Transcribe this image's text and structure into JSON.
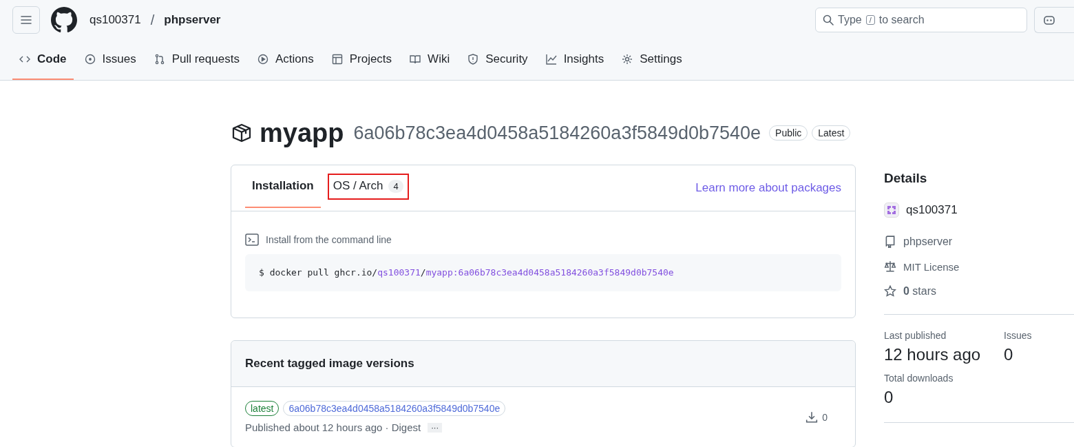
{
  "header": {
    "owner": "qs100371",
    "separator": "/",
    "repo": "phpserver",
    "search_parts": [
      "Type",
      "/",
      "to search"
    ]
  },
  "nav": [
    {
      "label": "Code",
      "kind": "code",
      "selected": true
    },
    {
      "label": "Issues",
      "kind": "issue",
      "selected": false
    },
    {
      "label": "Pull requests",
      "kind": "pr",
      "selected": false
    },
    {
      "label": "Actions",
      "kind": "play",
      "selected": false
    },
    {
      "label": "Projects",
      "kind": "table",
      "selected": false
    },
    {
      "label": "Wiki",
      "kind": "book",
      "selected": false
    },
    {
      "label": "Security",
      "kind": "shield",
      "selected": false
    },
    {
      "label": "Insights",
      "kind": "graph",
      "selected": false
    },
    {
      "label": "Settings",
      "kind": "gear",
      "selected": false
    }
  ],
  "package": {
    "name": "myapp",
    "digest": "6a06b78c3ea4d0458a5184260a3f5849d0b7540e",
    "badges": [
      "Public",
      "Latest"
    ]
  },
  "install_card": {
    "tabs": [
      {
        "label": "Installation",
        "selected": true,
        "highlighted": false
      },
      {
        "label": "OS / Arch",
        "count": "4",
        "selected": false,
        "highlighted": true
      }
    ],
    "learn_link": "Learn more about packages",
    "section_label": "Install from the command line",
    "command": [
      {
        "text": "$ docker pull ghcr.io/",
        "kind": "plain"
      },
      {
        "text": "qs100371",
        "kind": "link"
      },
      {
        "text": "/",
        "kind": "plain"
      },
      {
        "text": "myapp:6a06b78c3ea4d0458a5184260a3f5849d0b7540e",
        "kind": "link"
      }
    ]
  },
  "versions": {
    "title": "Recent tagged image versions",
    "rows": [
      {
        "tag": "latest",
        "digest": "6a06b78c3ea4d0458a5184260a3f5849d0b7540e",
        "meta": "Published about 12 hours ago · Digest",
        "more": "···",
        "downloads": "0"
      }
    ]
  },
  "details": {
    "title": "Details",
    "owner": "qs100371",
    "repo": "phpserver",
    "license": "MIT License",
    "stars_count": "0",
    "stars_label": "stars",
    "stats": [
      {
        "label": "Last published",
        "value": "12 hours ago"
      },
      {
        "label": "Issues",
        "value": "0"
      },
      {
        "label": "Total downloads",
        "value": "0"
      }
    ]
  }
}
